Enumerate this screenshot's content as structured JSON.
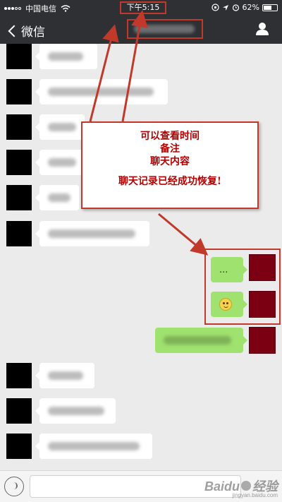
{
  "status_bar": {
    "carrier": "中国电信",
    "time": "下午5:15",
    "battery": "62%",
    "battery_level": 0.62
  },
  "nav": {
    "back_label": "微信"
  },
  "annotation": {
    "line1": "可以查看时间",
    "line2": "备注",
    "line3": "聊天内容",
    "line4": "聊天记录已经成功恢复!"
  },
  "messages": {
    "self_dots": "...",
    "self_emoji": "smiley-emoji-icon"
  },
  "watermark": {
    "brand": "Baidu",
    "suffix": "经验",
    "url": "jingyan.baidu.com"
  },
  "colors": {
    "accent_red": "#c0392b",
    "nav_bg": "#2e3034",
    "self_bubble": "#9fe26f"
  }
}
